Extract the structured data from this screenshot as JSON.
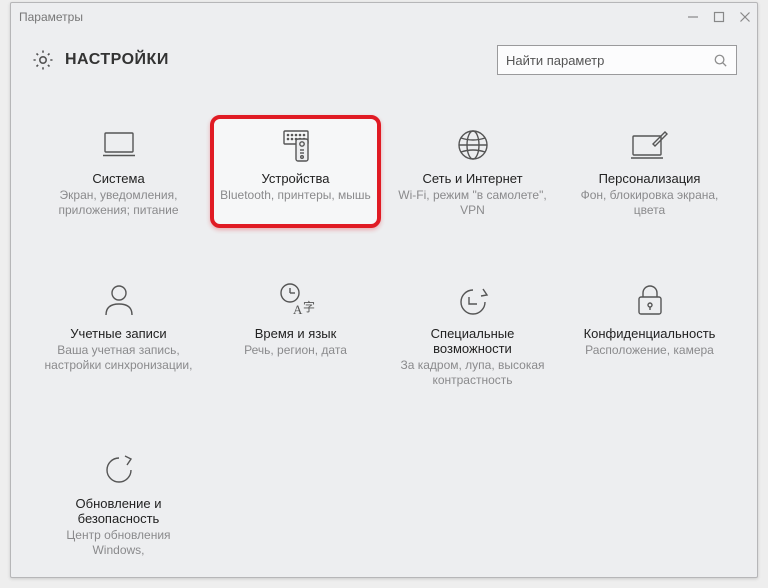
{
  "window": {
    "title": "Параметры"
  },
  "header": {
    "title": "НАСТРОЙКИ"
  },
  "search": {
    "placeholder": "Найти параметр"
  },
  "tiles": [
    {
      "title": "Система",
      "subtitle": "Экран, уведомления, приложения; питание"
    },
    {
      "title": "Устройства",
      "subtitle": "Bluetooth, принтеры, мышь"
    },
    {
      "title": "Сеть и Интернет",
      "subtitle": "Wi-Fi, режим \"в самолете\", VPN"
    },
    {
      "title": "Персонализация",
      "subtitle": "Фон, блокировка экрана, цвета"
    },
    {
      "title": "Учетные записи",
      "subtitle": "Ваша учетная запись, настройки синхронизации,"
    },
    {
      "title": "Время и язык",
      "subtitle": "Речь, регион, дата"
    },
    {
      "title": "Специальные возможности",
      "subtitle": "За кадром, лупа, высокая контрастность"
    },
    {
      "title": "Конфиденциальность",
      "subtitle": "Расположение, камера"
    },
    {
      "title": "Обновление и безопасность",
      "subtitle": "Центр обновления Windows,"
    }
  ],
  "highlight_index": 1
}
